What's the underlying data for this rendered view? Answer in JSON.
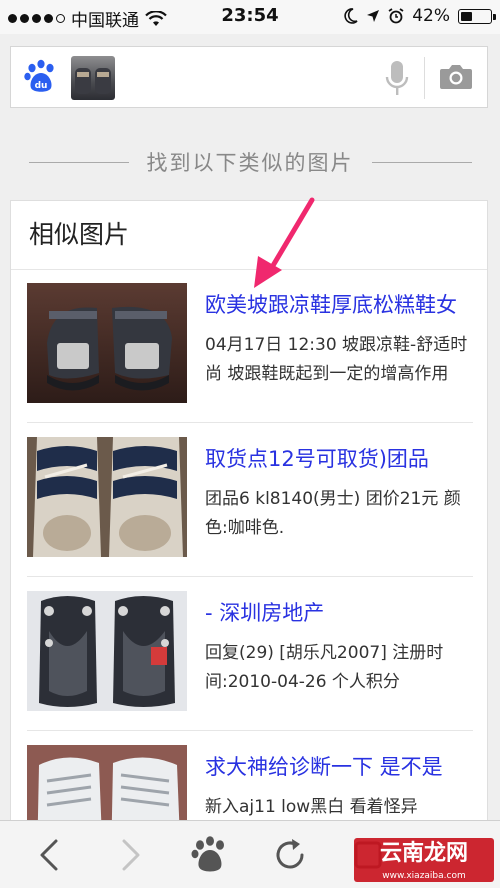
{
  "status_bar": {
    "carrier": "中国联通",
    "time": "23:54",
    "battery": "42%",
    "battery_level": 0.42,
    "signal_dots_filled": 4,
    "icons": [
      "wifi-icon",
      "moon-icon",
      "location-arrow-icon",
      "alarm-icon",
      "battery-icon"
    ]
  },
  "search": {
    "logo_text": "du",
    "icons": [
      "baidu-paw-icon",
      "microphone-icon",
      "camera-icon"
    ]
  },
  "heading": "找到以下类似的图片",
  "section": {
    "title": "相似图片",
    "results": [
      {
        "title": "欧美坡跟凉鞋厚底松糕鞋女",
        "desc": "04月17日 12:30 坡跟凉鞋-舒适时尚 坡跟鞋既起到一定的增高作用"
      },
      {
        "title": "取货点12号可取货)团品",
        "desc": "团品6 kl8140(男士) 团价21元 颜色:咖啡色."
      },
      {
        "title": "- 深圳房地产",
        "desc": "回复(29) [胡乐凡2007] 注册时间:2010-04-26 个人积分"
      },
      {
        "title": "求大神给诊断一下 是不是",
        "desc": "新入aj11 low黑白 看着怪异"
      }
    ]
  },
  "toolbar": {
    "icons": [
      "back-arrow-icon",
      "forward-arrow-icon",
      "baidu-paw-icon",
      "refresh-icon",
      "tabs-icon"
    ]
  },
  "watermark": {
    "text": "云南龙网",
    "sub": "www.xiazaiba.com"
  },
  "colors": {
    "link": "#2932e1",
    "annotation_arrow": "#f0286e",
    "baidu_blue": "#2b5ff0"
  }
}
